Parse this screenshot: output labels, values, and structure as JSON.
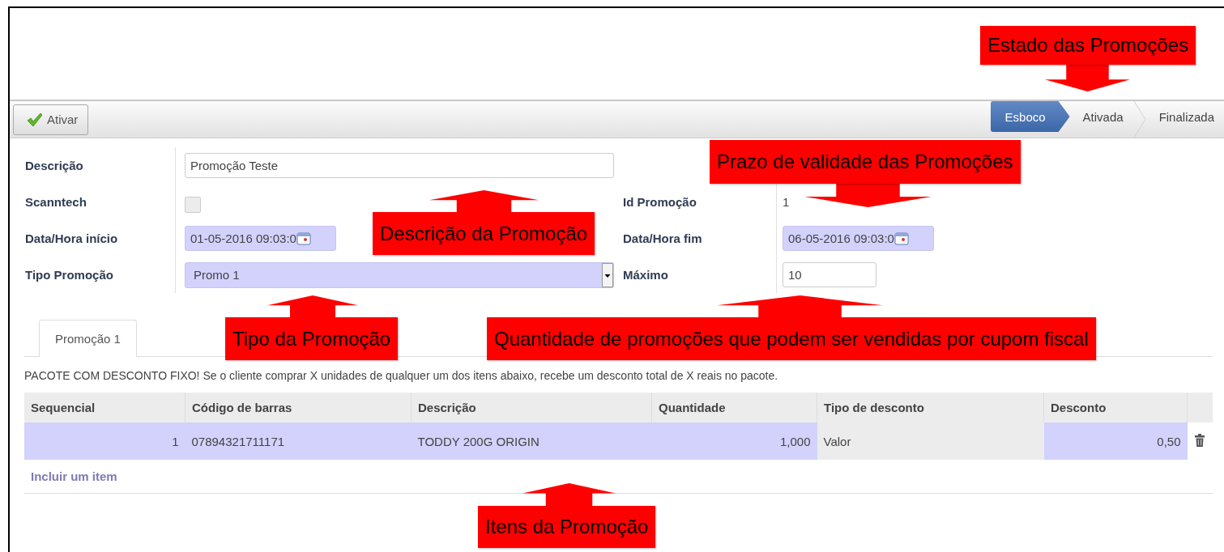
{
  "toolbar": {
    "buttons": [
      {
        "label": "Ativar"
      }
    ]
  },
  "stages": [
    {
      "label": "Esboco",
      "selected": true
    },
    {
      "label": "Ativada",
      "selected": false
    },
    {
      "label": "Finalizada",
      "selected": false
    }
  ],
  "form": {
    "left": [
      {
        "kind": "text",
        "label": "Descrição",
        "value": "Promoção Teste"
      },
      {
        "kind": "checkbox",
        "label": "Scanntech",
        "checked": false
      },
      {
        "kind": "datetime",
        "label": "Data/Hora início",
        "value": "01-05-2016 09:03:0"
      },
      {
        "kind": "select",
        "label": "Tipo Promoção",
        "value": "Promo 1"
      }
    ],
    "right": [
      {
        "kind": "readonly",
        "label": "Id Promoção",
        "value": "1"
      },
      {
        "kind": "datetime",
        "label": "Data/Hora fim",
        "value": "06-05-2016 09:03:0"
      },
      {
        "kind": "number",
        "label": "Máximo",
        "value": "10"
      }
    ]
  },
  "tabs": [
    {
      "label": "Promoção 1",
      "selected": true
    }
  ],
  "description": "PACOTE COM DESCONTO FIXO! Se o cliente comprar X unidades de qualquer um dos itens abaixo, recebe um desconto total de X reais no pacote.",
  "table": {
    "columns": [
      {
        "label": "Sequencial",
        "readonly": false
      },
      {
        "label": "Código de barras",
        "readonly": false
      },
      {
        "label": "Descrição",
        "readonly": false
      },
      {
        "label": "Quantidade",
        "readonly": false
      },
      {
        "label": "Tipo de desconto",
        "readonly": true
      },
      {
        "label": "Desconto",
        "readonly": false
      }
    ],
    "rows": [
      {
        "cells": [
          "1",
          "07894321711171",
          "TODDY 200G ORIGIN",
          "1,000",
          "Valor",
          "0,50"
        ]
      }
    ],
    "add_link": "Incluir um item"
  },
  "annotations": [
    {
      "text": "Estado das Promoções",
      "kind": "down"
    },
    {
      "text": "Prazo de validade das Promoções",
      "kind": "down"
    },
    {
      "text": "Descrição da Promoção",
      "kind": "up"
    },
    {
      "text": "Tipo da Promoção",
      "kind": "up"
    },
    {
      "text": "Quantidade de promoções que podem ser vendidas por cupom fiscal",
      "kind": "up"
    },
    {
      "text": "Itens da Promoção",
      "kind": "up"
    }
  ]
}
